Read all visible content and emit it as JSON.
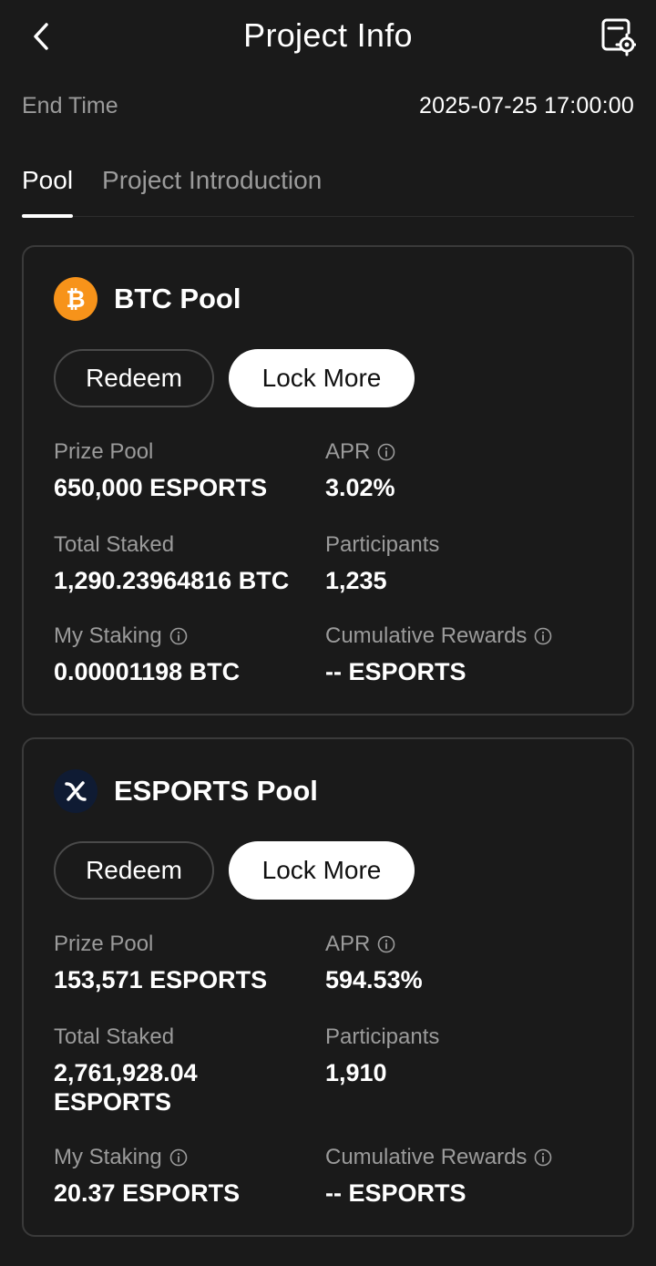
{
  "header": {
    "title": "Project Info",
    "back_icon": "chevron-left-icon",
    "settings_icon": "settings-document-icon"
  },
  "end_time": {
    "label": "End Time",
    "value": "2025-07-25 17:00:00"
  },
  "tabs": [
    {
      "label": "Pool",
      "active": true
    },
    {
      "label": "Project Introduction",
      "active": false
    }
  ],
  "pools": [
    {
      "name": "BTC Pool",
      "coin_icon": "bitcoin-icon",
      "coin_color": "#f7931a",
      "redeem_label": "Redeem",
      "lock_label": "Lock More",
      "stats": {
        "prize_pool_label": "Prize Pool",
        "prize_pool_value": "650,000 ESPORTS",
        "apr_label": "APR",
        "apr_value": "3.02%",
        "total_staked_label": "Total Staked",
        "total_staked_value": "1,290.23964816 BTC",
        "participants_label": "Participants",
        "participants_value": "1,235",
        "my_staking_label": "My Staking",
        "my_staking_value": "0.00001198 BTC",
        "cumulative_label": "Cumulative Rewards",
        "cumulative_value": "-- ESPORTS"
      }
    },
    {
      "name": "ESPORTS Pool",
      "coin_icon": "esports-logo-icon",
      "coin_color": "#0f1b33",
      "redeem_label": "Redeem",
      "lock_label": "Lock More",
      "stats": {
        "prize_pool_label": "Prize Pool",
        "prize_pool_value": "153,571 ESPORTS",
        "apr_label": "APR",
        "apr_value": "594.53%",
        "total_staked_label": "Total Staked",
        "total_staked_value": "2,761,928.04 ESPORTS",
        "participants_label": "Participants",
        "participants_value": "1,910",
        "my_staking_label": "My Staking",
        "my_staking_value": "20.37 ESPORTS",
        "cumulative_label": "Cumulative Rewards",
        "cumulative_value": "-- ESPORTS"
      }
    }
  ]
}
